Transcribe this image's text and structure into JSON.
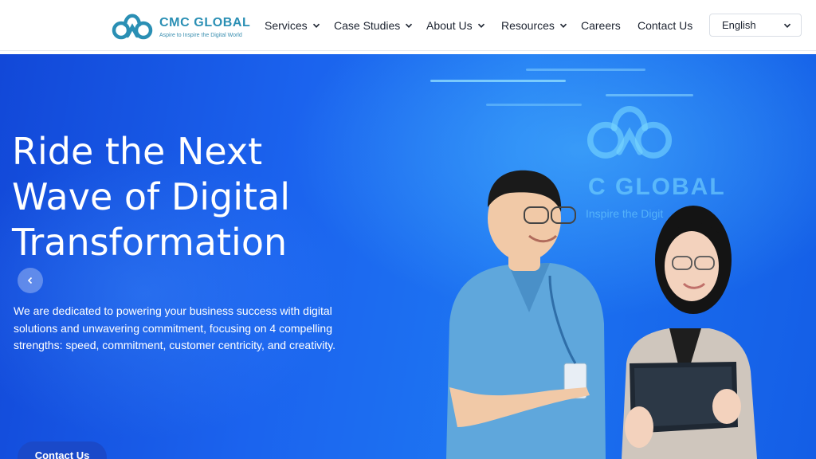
{
  "header": {
    "logo_name": "CMC GLOBAL",
    "logo_tagline": "Aspire to Inspire the Digital World",
    "nav": [
      {
        "label": "Services",
        "dropdown": true
      },
      {
        "label": "Case Studies",
        "dropdown": true
      },
      {
        "label": "About Us",
        "dropdown": true
      },
      {
        "label": "Resources",
        "dropdown": true
      },
      {
        "label": "Careers",
        "dropdown": false
      },
      {
        "label": "Contact Us",
        "dropdown": false
      }
    ],
    "language": "English"
  },
  "hero": {
    "title_lines": [
      "Ride the Next",
      "Wave of Digital",
      "Transformation"
    ],
    "description": "We are dedicated to powering your business success with digital solutions and unwavering commitment, focusing on 4 compelling strengths: speed, commitment, customer centricity, and creativity.",
    "cta_label": "Contact Us",
    "background_sign": "C GLOBAL",
    "background_sign_sub": "Inspire the Digit"
  },
  "colors": {
    "brand": "#2a8fb4",
    "hero_blue": "#1d6cf0",
    "cta": "#1a49c9"
  },
  "icons": {
    "logo": "cmc-cloud-logo",
    "dropdown": "chevron-down-icon",
    "carousel_prev": "chevron-left-icon"
  }
}
